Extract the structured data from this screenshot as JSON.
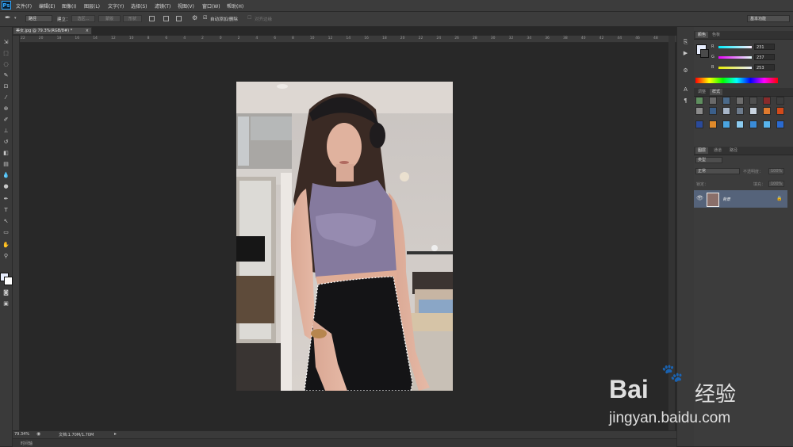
{
  "app": {
    "logo": "Ps"
  },
  "menubar": {
    "items": [
      "文件(F)",
      "编辑(E)",
      "图像(I)",
      "图层(L)",
      "文字(Y)",
      "选择(S)",
      "滤镜(T)",
      "视图(V)",
      "窗口(W)",
      "帮助(H)"
    ]
  },
  "options": {
    "mode_select": "路径",
    "build_label": "建立：",
    "btn_selection": "选区...",
    "btn_mask": "蒙版",
    "btn_shape": "形状",
    "auto_add_delete": "自动添加/删除",
    "align_edges": "对齐边缘",
    "workspace": "基本功能"
  },
  "document": {
    "tab_title": "美女.jpg @ 79.3%(RGB/8#) *",
    "tab_close": "×",
    "zoom": "79.34%",
    "doc_info": "文档:1.70M/1.70M",
    "ruler_ticks": [
      "22",
      "20",
      "18",
      "16",
      "14",
      "12",
      "10",
      "8",
      "6",
      "4",
      "2",
      "0",
      "2",
      "4",
      "6",
      "8",
      "10",
      "12",
      "14",
      "16",
      "18",
      "20",
      "22",
      "24",
      "26",
      "28",
      "30",
      "32",
      "34",
      "36",
      "38",
      "40",
      "42",
      "44",
      "46",
      "48"
    ],
    "timeline_label": "时间轴"
  },
  "panels": {
    "color_tabs": [
      "颜色",
      "色板"
    ],
    "color": {
      "channels": [
        {
          "label": "R",
          "value": "231",
          "color": "#e7eefd"
        },
        {
          "label": "G",
          "value": "237",
          "color": "#e7eefd"
        },
        {
          "label": "B",
          "value": "253",
          "color": "#e7eefd"
        }
      ],
      "foreground": "#e7edfd"
    },
    "style_tabs": [
      "调整",
      "样式"
    ],
    "layer_tabs": [
      "图层",
      "通道",
      "路径"
    ],
    "layers": {
      "filter_kind": "类型",
      "blend_mode": "正常",
      "opacity_label": "不透明度：",
      "opacity_value": "100%",
      "lock_label": "锁定：",
      "fill_label": "填充：",
      "fill_value": "100%",
      "layer_name": "背景"
    }
  },
  "watermark": {
    "brand": "Bai",
    "brand2": "经验",
    "url": "jingyan.baidu.com"
  }
}
